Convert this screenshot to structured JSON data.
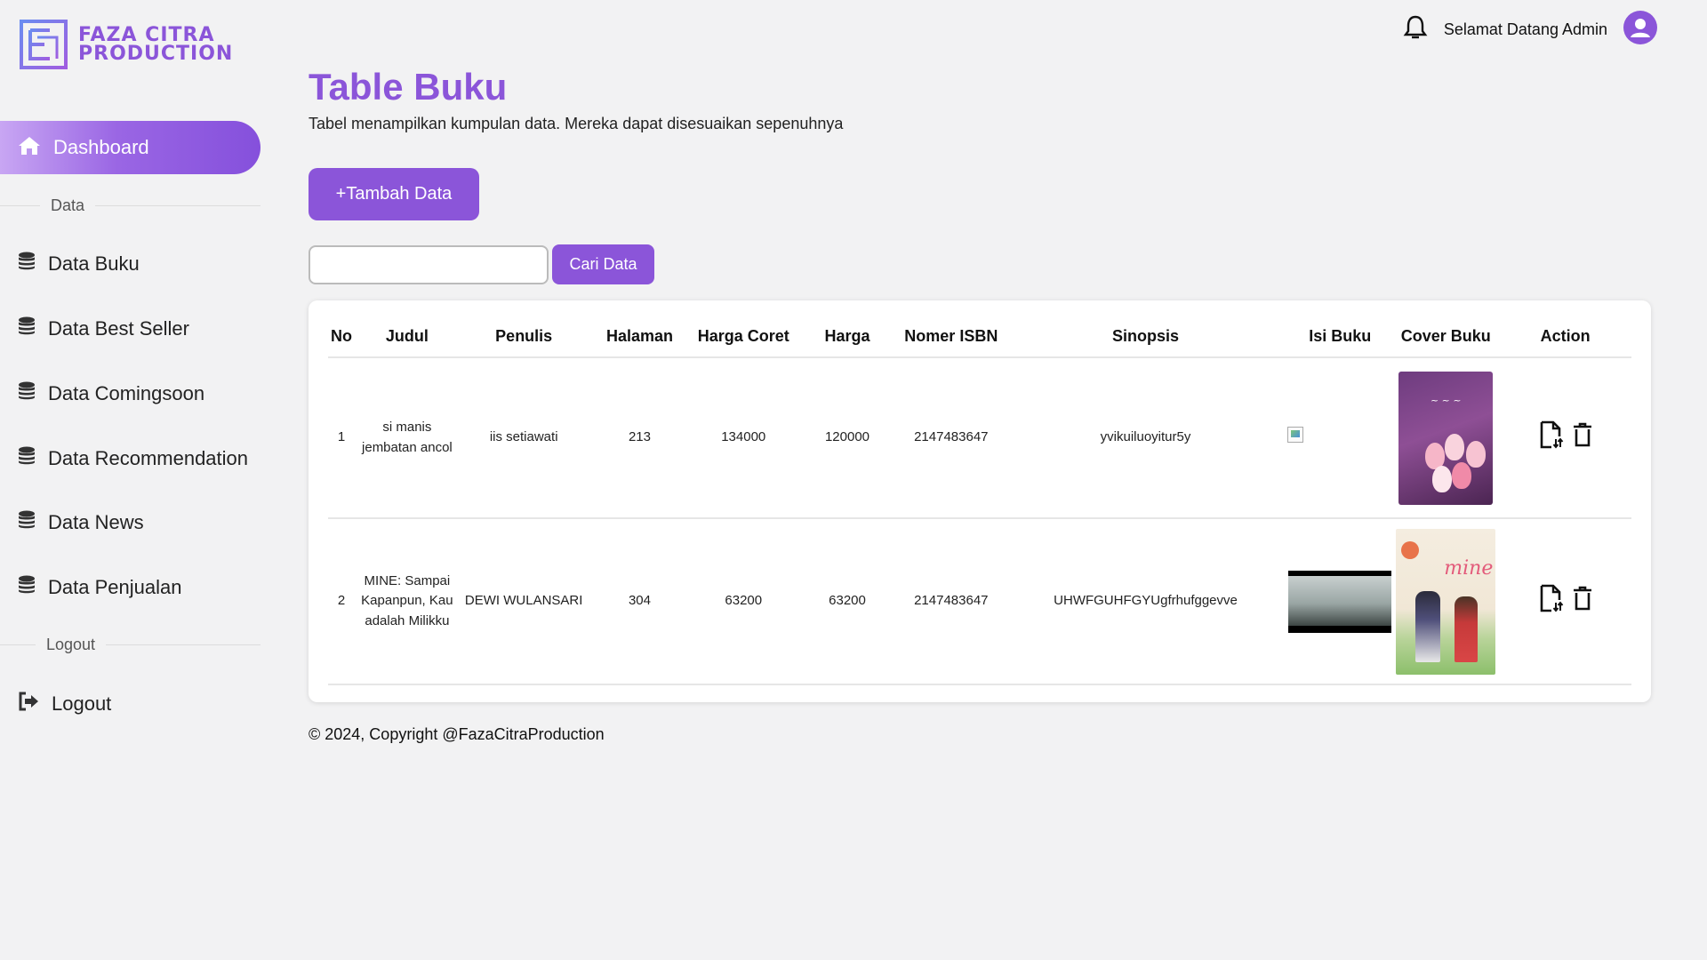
{
  "brand": {
    "line1": "FAZA CITRA",
    "line2": "PRODUCTION",
    "accent": "#8b55d9"
  },
  "header": {
    "welcome": "Selamat Datang Admin"
  },
  "sidebar": {
    "active": {
      "label": "Dashboard",
      "icon": "home-icon"
    },
    "section_data": "Data",
    "items": [
      {
        "label": "Data Buku",
        "icon": "database-icon"
      },
      {
        "label": "Data Best Seller",
        "icon": "database-icon"
      },
      {
        "label": "Data Comingsoon",
        "icon": "database-icon"
      },
      {
        "label": "Data Recommendation",
        "icon": "database-icon"
      },
      {
        "label": "Data News",
        "icon": "database-icon"
      },
      {
        "label": "Data Penjualan",
        "icon": "database-icon"
      }
    ],
    "section_logout": "Logout",
    "logout": {
      "label": "Logout",
      "icon": "sign-out-icon"
    }
  },
  "main": {
    "title": "Table Buku",
    "subtitle": "Tabel menampilkan kumpulan data. Mereka dapat disesuaikan sepenuhnya",
    "add_button": "+Tambah Data",
    "search": {
      "value": "",
      "button": "Cari Data"
    }
  },
  "table": {
    "headers": [
      "No",
      "Judul",
      "Penulis",
      "Halaman",
      "Harga Coret",
      "Harga",
      "Nomer ISBN",
      "Sinopsis",
      "Isi Buku",
      "Cover Buku",
      "Action"
    ],
    "rows": [
      {
        "no": "1",
        "judul": "si manis jembatan ancol",
        "penulis": "iis setiawati",
        "halaman": "213",
        "harga_coret": "134000",
        "harga": "120000",
        "isbn": "2147483647",
        "sinopsis": "yvikuiluoyitur5y"
      },
      {
        "no": "2",
        "judul": "MINE: Sampai Kapanpun, Kau adalah Milikku",
        "penulis": "DEWI WULANSARI",
        "halaman": "304",
        "harga_coret": "63200",
        "harga": "63200",
        "isbn": "2147483647",
        "sinopsis": "UHWFGUHFGYUgfrhufggevve"
      }
    ]
  },
  "footer": "© 2024, Copyright @FazaCitraProduction"
}
